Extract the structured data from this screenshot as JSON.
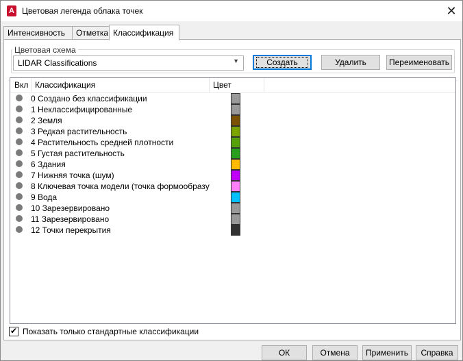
{
  "window": {
    "title": "Цветовая легенда облака точек",
    "app_icon_letter": "A"
  },
  "tabs": [
    {
      "label": "Интенсивность",
      "active": false
    },
    {
      "label": "Отметка",
      "active": false
    },
    {
      "label": "Классификация",
      "active": true
    }
  ],
  "color_scheme": {
    "legend": "Цветовая схема",
    "selected": "LIDAR Classifications",
    "create_label": "Создать",
    "delete_label": "Удалить",
    "rename_label": "Переименовать"
  },
  "table": {
    "headers": {
      "enabled": "Вкл",
      "classification": "Классификация",
      "color": "Цвет"
    },
    "rows": [
      {
        "label": "0 Создано без классификации",
        "color": "#999999"
      },
      {
        "label": "1 Неклассифицированные",
        "color": "#9a9a9a"
      },
      {
        "label": "2 Земля",
        "color": "#7a5200"
      },
      {
        "label": "3 Редкая растительность",
        "color": "#7ba200"
      },
      {
        "label": "4 Растительность средней плотности",
        "color": "#56a10a"
      },
      {
        "label": "5 Густая растительность",
        "color": "#28a01e"
      },
      {
        "label": "6 Здания",
        "color": "#ffba00"
      },
      {
        "label": "7 Нижняя точка (шум)",
        "color": "#c000ff"
      },
      {
        "label": "8 Ключевая точка модели (точка формообразу",
        "color": "#ff80ff"
      },
      {
        "label": "9 Вода",
        "color": "#00c0ff"
      },
      {
        "label": "10 Зарезервировано",
        "color": "#999999"
      },
      {
        "label": "11 Зарезервировано",
        "color": "#9a9a9a"
      },
      {
        "label": "12 Точки перекрытия",
        "color": "#333333"
      }
    ]
  },
  "options": {
    "standard_only_label": "Показать только стандартные классификации",
    "standard_only_checked": true
  },
  "footer": {
    "ok_label": "ОК",
    "cancel_label": "Отмена",
    "apply_label": "Применить",
    "help_label": "Справка"
  }
}
